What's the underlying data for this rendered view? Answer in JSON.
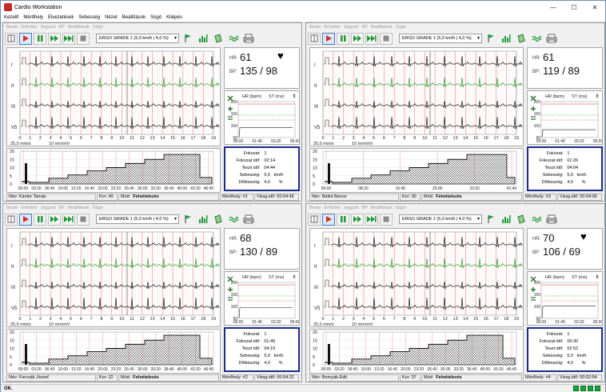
{
  "window": {
    "title": "Cardio Workstation",
    "minimize": "—",
    "maximize": "☐",
    "close": "✕"
  },
  "menu": [
    "Kezelő",
    "Mérőhely",
    "Elvezetések",
    "Sebesség",
    "Nézet",
    "Beállítások",
    "Súgó",
    "Kilépés"
  ],
  "station_menu": [
    "Bezár",
    "Erősítés",
    "Jegyzet",
    "BP",
    "Beállítások",
    "Súgó"
  ],
  "protocol": "ERGO GRADE 1 (5,0 km/h | 4,0 %)",
  "leads": [
    "I",
    "II",
    "III",
    "V5"
  ],
  "ecg_scale": {
    "speed": "25,0 mm/s",
    "gain": "10 mm/mV",
    "ticks": [
      "0",
      "1",
      "2",
      "3",
      "4",
      "5",
      "6",
      "7",
      "8",
      "9",
      "10",
      "11",
      "12",
      "13",
      "14",
      "15",
      "16",
      "17",
      "18",
      "19"
    ]
  },
  "trend_y_ticks": [
    "20",
    "15",
    "10",
    "5",
    "0"
  ],
  "trend_x_full": [
    "00:00",
    "03:20",
    "06:40",
    "10:00",
    "13:20",
    "16:40",
    "20:00",
    "23:20",
    "26:40",
    "30:00",
    "33:20",
    "36:40",
    "40:00",
    "43:20",
    "46:40"
  ],
  "trend_x_partial": [
    "00:00",
    "08:20",
    "16:40",
    "25:00",
    "33:20",
    "41:40"
  ],
  "mini_chart": {
    "hr_label": "HR (bpm)",
    "st_label": "ST (ms)",
    "pause": "II",
    "y_ticks": [
      "200",
      "150",
      "100",
      "50"
    ],
    "x_ticks": [
      "00:00",
      "01:40",
      "03:20",
      "05:00"
    ]
  },
  "labels": {
    "hr": "HR:",
    "bp": "BP:",
    "name": "Név:",
    "age": "Kor:",
    "mode": "Mód:",
    "mode_value": "Felvételezés",
    "station": "Mérőhely:",
    "test_time": "Vizsg.idő:",
    "level": "Fokozat:",
    "level_time": "Fokozat idő:",
    "total_time": "Teszt idő:",
    "speed": "Sebesség:",
    "slope": "Dőlésszög:",
    "kmh": "km/h",
    "pct": "%"
  },
  "stations": [
    {
      "hr": "61",
      "bp": "135 / 98",
      "heart": true,
      "name": "Kántor Tamás",
      "age": "49",
      "station": "#1",
      "test_time": "00:04:45",
      "level": "1",
      "level_time": "02:14",
      "total_time": "04:44",
      "speed": "5,0",
      "slope": "4,0",
      "axis": "full",
      "hr_level": 0.72,
      "trend_end": 0.93
    },
    {
      "hr": "61",
      "bp": "119 / 89",
      "heart": false,
      "name": "Bálint Bence",
      "age": "30",
      "station": "#3",
      "test_time": "00:04:06",
      "level": "1",
      "level_time": "01:26",
      "total_time": "04:04",
      "speed": "5,0",
      "slope": "4,0",
      "axis": "partial",
      "hr_level": 0.78,
      "trend_end": 0.95
    },
    {
      "hr": "68",
      "bp": "130 / 89",
      "heart": false,
      "name": "Fercsák József",
      "age": "22",
      "station": "#2",
      "test_time": "00:04:22",
      "level": "1",
      "level_time": "01:49",
      "total_time": "04:19",
      "speed": "5,0",
      "slope": "4,0",
      "axis": "full",
      "hr_level": 0.7,
      "trend_end": 0.93
    },
    {
      "hr": "70",
      "bp": "106 / 69",
      "heart": true,
      "name": "Bornyák Edit",
      "age": "37",
      "station": "#4",
      "test_time": "00:02:54",
      "level": "1",
      "level_time": "00:30",
      "total_time": "02:52",
      "speed": "5,0",
      "slope": "4,0",
      "axis": "full",
      "hr_level": 0.66,
      "trend_end": 0.93
    }
  ],
  "statusbar": {
    "text": "OK."
  },
  "colors": {
    "grid": "#f3b2b2",
    "trace": "#1a1a1a",
    "green_trace": "#2e9a2e",
    "accent": "#1c2c8a",
    "st_line": "#37b337",
    "st_red": "#e23a3a"
  }
}
